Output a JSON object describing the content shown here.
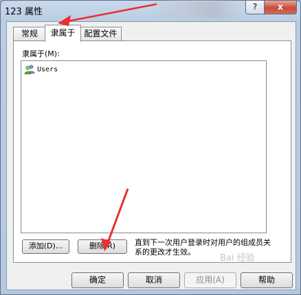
{
  "window": {
    "title": "123 属性"
  },
  "titlebar": {
    "help_label": "?",
    "close_label": "x"
  },
  "tabs": [
    {
      "label": "常规"
    },
    {
      "label": "隶属于"
    },
    {
      "label": "配置文件"
    }
  ],
  "panel": {
    "member_label": "隶属于(M):",
    "items": [
      {
        "label": "Users",
        "icon": "group-icon"
      }
    ],
    "add_label": "添加(D)...",
    "remove_label": "删除(R)",
    "note": "直到下一次用户登录时对用户的组成员关系的更改才生效。"
  },
  "footer": {
    "ok_label": "确定",
    "cancel_label": "取消",
    "apply_label": "应用(A)",
    "help_label": "帮助"
  },
  "watermark": "Bai 经验",
  "colors": {
    "arrow": "#e8302e",
    "title_gradient_top": "#c9d9ea",
    "close": "#c84c3a"
  }
}
